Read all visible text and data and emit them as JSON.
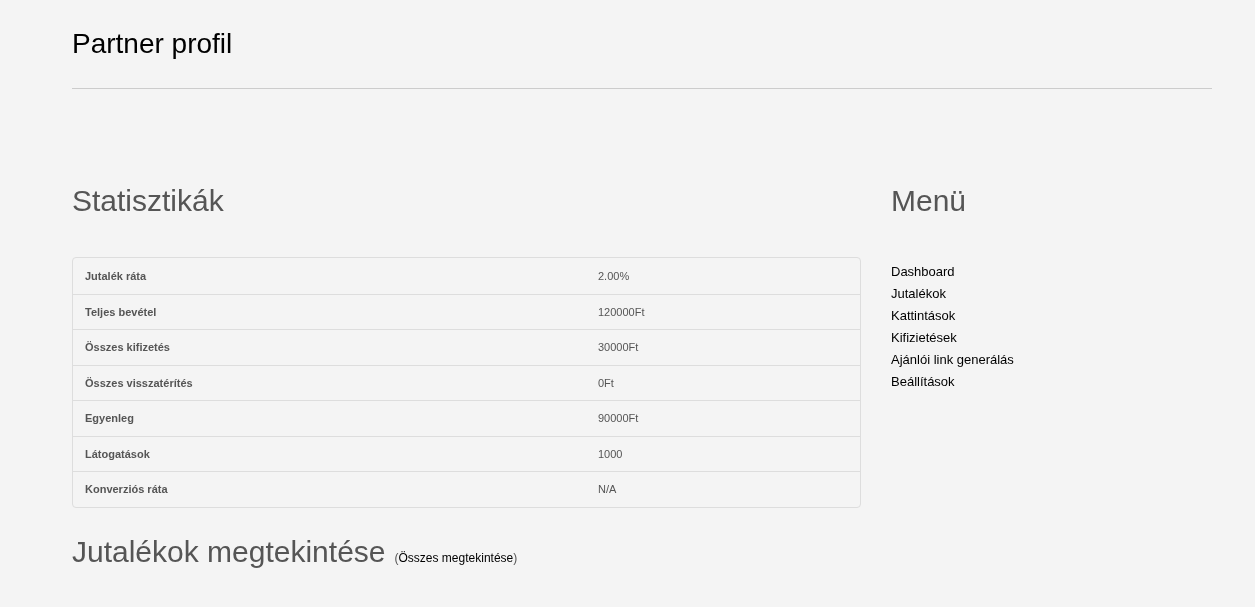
{
  "page_title": "Partner profil",
  "stats": {
    "heading": "Statisztikák",
    "rows": [
      {
        "label": "Jutalék ráta",
        "value": "2.00%"
      },
      {
        "label": "Teljes bevétel",
        "value": "120000Ft"
      },
      {
        "label": "Összes kifizetés",
        "value": "30000Ft"
      },
      {
        "label": "Összes visszatérítés",
        "value": "0Ft"
      },
      {
        "label": "Egyenleg",
        "value": "90000Ft"
      },
      {
        "label": "Látogatások",
        "value": "1000"
      },
      {
        "label": "Konverziós ráta",
        "value": "N/A"
      }
    ]
  },
  "commissions": {
    "heading": "Jutalékok megtekintése",
    "open": "(",
    "link": "Összes megtekintése",
    "close": ")"
  },
  "menu": {
    "heading": "Menü",
    "items": [
      "Dashboard",
      "Jutalékok",
      "Kattintások",
      "Kifizietések",
      "Ajánlói link generálás",
      "Beállítások"
    ]
  }
}
